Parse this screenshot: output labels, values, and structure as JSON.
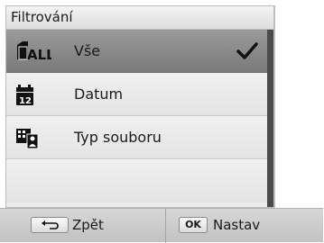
{
  "header": {
    "title": "Filtrování"
  },
  "items": [
    {
      "label": "Vše",
      "icon": "all-files-icon",
      "selected": true
    },
    {
      "label": "Datum",
      "icon": "calendar-date-icon",
      "selected": false
    },
    {
      "label": "Typ souboru",
      "icon": "file-type-icon",
      "selected": false
    }
  ],
  "footer": {
    "back_key": "back-arrow-icon",
    "back_label": "Zpět",
    "ok_key": "OK",
    "ok_label": "Nastav"
  },
  "colors": {
    "selected_row": "#8a8a8a",
    "background": "#eaeaea",
    "text": "#1a1a1a"
  }
}
